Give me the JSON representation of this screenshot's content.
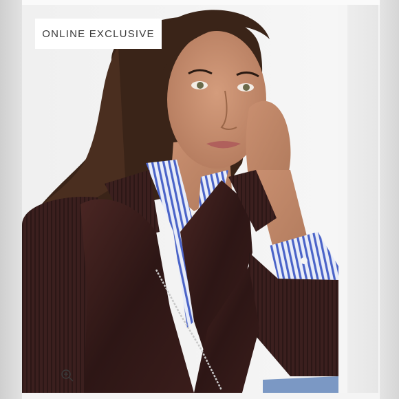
{
  "product_image": {
    "badge_label": "ONLINE EXCLUSIVE",
    "alt": "Model wearing a dark brown faux-leather sweater jacket over a blue-striped button-down shirt",
    "zoom_icon": "zoom-in-icon"
  },
  "colors": {
    "badge_bg": "#ffffff",
    "badge_text": "#3a3a3a",
    "jacket": "#3a1e1c",
    "shirt_stripe": "#4a63c8",
    "background": "#efefef"
  }
}
